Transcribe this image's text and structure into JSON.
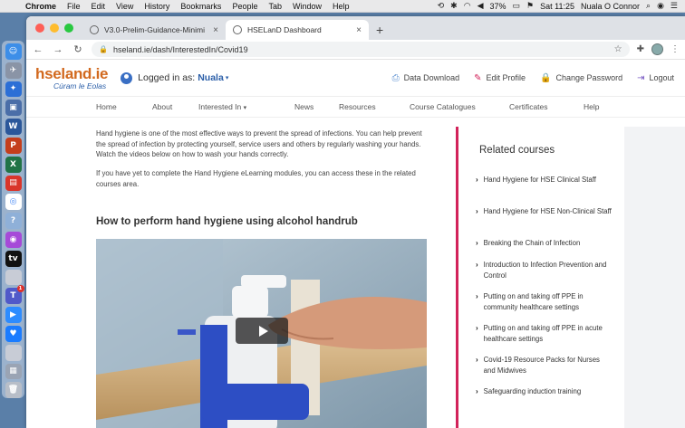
{
  "menubar": {
    "app": "Chrome",
    "items": [
      "File",
      "Edit",
      "View",
      "History",
      "Bookmarks",
      "People",
      "Tab",
      "Window",
      "Help"
    ],
    "battery": "37%",
    "clock": "Sat 11:25",
    "user": "Nuala O Connor"
  },
  "browser": {
    "tabs": [
      {
        "title": "V3.0-Prelim-Guidance-Minimi"
      },
      {
        "title": "HSELanD Dashboard"
      }
    ],
    "url": "hseland.ie/dash/InterestedIn/Covid19"
  },
  "site": {
    "logo_main": "hseland.ie",
    "logo_sub": "Cúram le Eolas",
    "logged_in_label": "Logged in as:",
    "user_name": "Nuala",
    "header_links": [
      "Data Download",
      "Edit Profile",
      "Change Password",
      "Logout"
    ],
    "nav": [
      "Home",
      "About",
      "Interested In",
      "News",
      "Resources",
      "Course Catalogues",
      "Certificates",
      "Help"
    ]
  },
  "main": {
    "para1": "Hand hygiene is one of the most effective ways to prevent the spread of infections. You can help prevent the spread of infection by protecting yourself, service users and others by regularly washing your hands. Watch the videos below on how to wash your hands correctly.",
    "para2": "If you have yet to complete the Hand Hygiene eLearning modules, you can access these in the related courses area.",
    "section_title": "How to perform hand hygiene using alcohol handrub"
  },
  "related": {
    "title": "Related courses",
    "courses": [
      "Hand Hygiene for HSE Clinical Staff",
      "Hand Hygiene for HSE Non-Clinical Staff",
      "Breaking the Chain of Infection",
      "Introduction to Infection Prevention and Control",
      "Putting on and taking off PPE in community healthcare settings",
      "Putting on and taking off PPE in acute healthcare settings",
      "Covid-19 Resource Packs for Nurses and Midwives",
      "Safeguarding induction training"
    ]
  },
  "colors": {
    "accent_pink": "#d2235a",
    "logo_orange": "#d2691e",
    "logo_blue": "#2a5ea8"
  }
}
